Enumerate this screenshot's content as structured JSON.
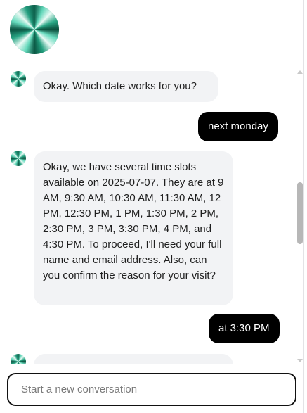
{
  "brand": {
    "logo_icon": "green-spiral-logo-icon"
  },
  "messages": [
    {
      "role": "assistant",
      "text": "Okay. Which date works for you?"
    },
    {
      "role": "user",
      "text": "next monday"
    },
    {
      "role": "assistant",
      "text": "Okay, we have several time slots available on 2025-07-07. They are at 9 AM, 9:30 AM, 10:30 AM, 11:30 AM, 12 PM, 12:30 PM, 1 PM, 1:30 PM, 2 PM, 2:30 PM, 3 PM, 3:30 PM, 4 PM, and 4:30 PM. To proceed, I'll need your full name and email address. Also, can you confirm the reason for your visit?"
    },
    {
      "role": "user",
      "text": "at 3:30 PM"
    },
    {
      "role": "assistant",
      "text": ""
    }
  ],
  "composer": {
    "placeholder": "Start a new conversation"
  },
  "colors": {
    "user_bubble": "#000000",
    "assistant_bubble": "#f2f3f5",
    "input_border": "#111111"
  }
}
